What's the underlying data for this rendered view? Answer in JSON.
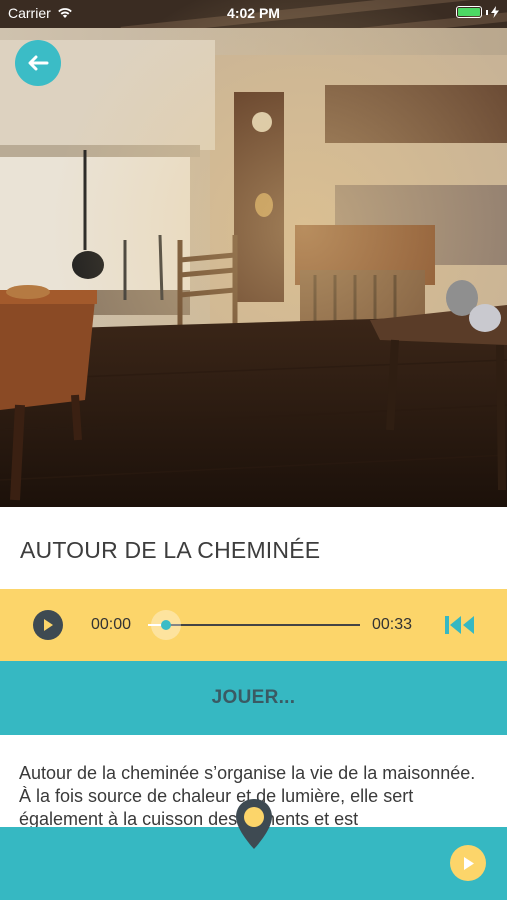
{
  "status_bar": {
    "carrier": "Carrier",
    "time": "4:02 PM"
  },
  "header": {
    "back_icon": "arrow-left-icon"
  },
  "exhibit": {
    "title": "AUTOUR DE LA CHEMINÉE",
    "description": "Autour de la cheminée s’organise la vie de la maisonnée. À la fois source de chaleur et de lumière, elle sert également à la cuisson des aliments et est"
  },
  "player": {
    "current_time": "00:00",
    "total_time": "00:33",
    "progress": 0.08,
    "play_icon": "play-icon",
    "rewind_icon": "skip-back-icon"
  },
  "actions": {
    "play_label": "JOUER..."
  },
  "footer": {
    "map_icon": "map-pin-icon",
    "next_icon": "play-icon"
  },
  "colors": {
    "accent_teal": "#36b8c2",
    "accent_yellow": "#fcd56a",
    "dark": "#3e4a52"
  }
}
